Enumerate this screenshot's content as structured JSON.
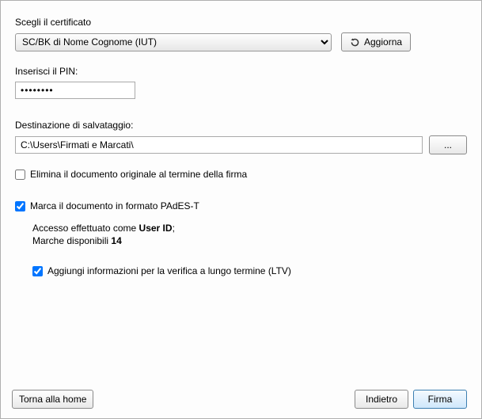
{
  "certificate": {
    "label": "Scegli il certificato",
    "selected": "SC/BK di Nome Cognome (IUT)",
    "refresh_label": "Aggiorna"
  },
  "pin": {
    "label": "Inserisci il PIN:",
    "value": "••••••••"
  },
  "destination": {
    "label": "Destinazione di salvataggio:",
    "value": "C:\\Users\\Firmati e Marcati\\",
    "browse_label": "..."
  },
  "options": {
    "delete_original": {
      "label": "Elimina il documento originale al termine della firma",
      "checked": false
    },
    "mark_pades": {
      "label": "Marca il documento in formato PAdES-T",
      "checked": true
    },
    "ltv": {
      "label": "Aggiungi informazioni per la verifica a lungo termine (LTV)",
      "checked": true
    }
  },
  "status": {
    "access_prefix": "Accesso effettuato come ",
    "user_id": "User ID",
    "access_suffix": ";",
    "marks_prefix": "Marche disponibili ",
    "marks_count": "14"
  },
  "buttons": {
    "home": "Torna alla home",
    "back": "Indietro",
    "sign": "Firma"
  }
}
